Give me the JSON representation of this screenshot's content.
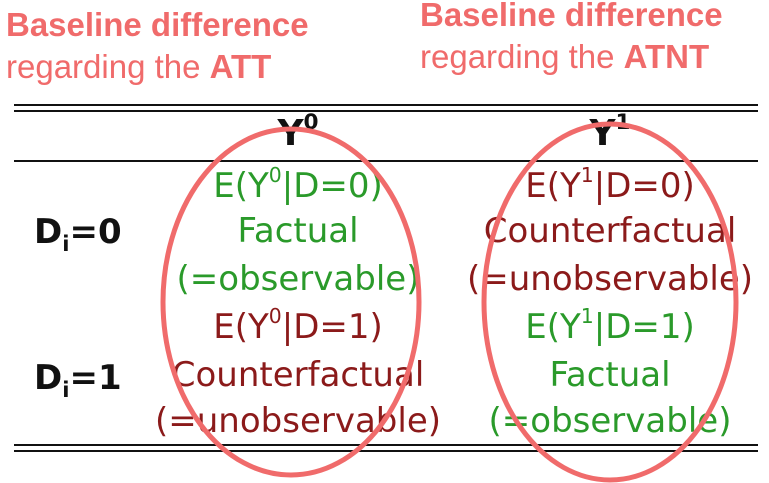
{
  "annotations": {
    "att": {
      "line1": "Baseline difference",
      "line2_prefix": "regarding the ",
      "line2_bold": "ATT"
    },
    "atnt": {
      "line1": "Baseline difference",
      "line2_prefix": "regarding the ",
      "line2_bold": "ATNT"
    }
  },
  "table": {
    "col_headers": [
      {
        "base": "Y",
        "sup": "0"
      },
      {
        "base": "Y",
        "sup": "1"
      }
    ],
    "row_labels": [
      {
        "base": "D",
        "sub": "i",
        "rest": "=0"
      },
      {
        "base": "D",
        "sub": "i",
        "rest": "=1"
      }
    ],
    "cells": {
      "r0c0": {
        "pre": "E(Y",
        "sup": "0",
        "post": "|D=0)",
        "line2": "Factual",
        "line3": "(=observable)",
        "status": "factual"
      },
      "r0c1": {
        "pre": "E(Y",
        "sup": "1",
        "post": "|D=0)",
        "line2": "Counterfactual",
        "line3": "(=unobservable)",
        "status": "counterfactual"
      },
      "r1c0": {
        "pre": "E(Y",
        "sup": "0",
        "post": "|D=1)",
        "line2": "Counterfactual",
        "line3": "(=unobservable)",
        "status": "counterfactual"
      },
      "r1c1": {
        "pre": "E(Y",
        "sup": "1",
        "post": "|D=1)",
        "line2": "Factual",
        "line3": "(=observable)",
        "status": "factual"
      }
    }
  },
  "colors": {
    "annotation": "#f06b6b",
    "factual": "#2a9a2a",
    "counterfactual": "#8b1a1a",
    "oval": "#f06b6b"
  }
}
